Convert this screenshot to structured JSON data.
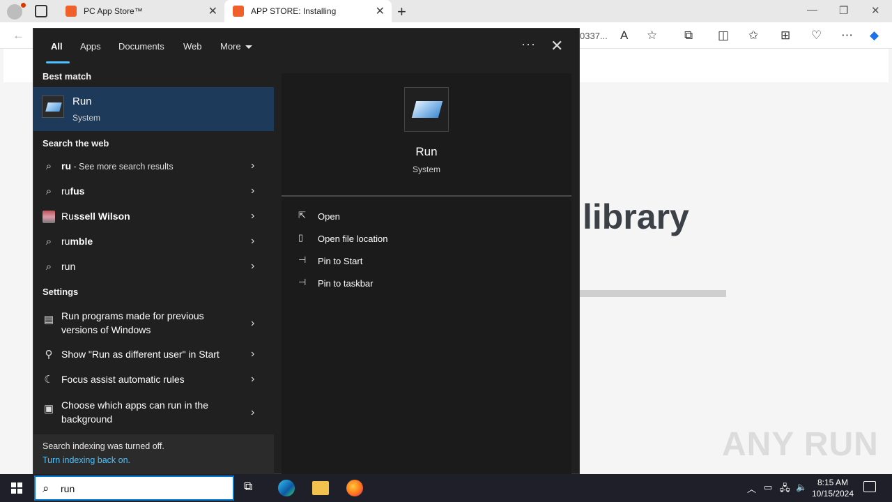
{
  "browser": {
    "tabs": [
      {
        "title": "PC App Store™"
      },
      {
        "title": "APP STORE: Installing"
      }
    ],
    "url_fragment": "0337..."
  },
  "page": {
    "heading": "library",
    "watermark": "ANY RUN"
  },
  "search": {
    "query": "run",
    "tabs": [
      "All",
      "Apps",
      "Documents",
      "Web",
      "More"
    ],
    "best_match_header": "Best match",
    "best_match": {
      "title": "Run",
      "subtitle": "System"
    },
    "web_header": "Search the web",
    "web_results": [
      {
        "prefix": "ru",
        "suffix": " - See more search results",
        "icon": "search-icon"
      },
      {
        "prefix": "ru",
        "suffix": "fus",
        "icon": "search-icon"
      },
      {
        "prefix": "Ru",
        "suffix": "ssell Wilson",
        "icon": "avatar-image"
      },
      {
        "prefix": "ru",
        "suffix": "mble",
        "icon": "search-icon"
      },
      {
        "prefix": "run",
        "suffix": "",
        "icon": "search-icon"
      }
    ],
    "settings_header": "Settings",
    "settings_results": [
      {
        "text": "Run programs made for previous versions of Windows",
        "icon": "compatibility-icon"
      },
      {
        "text": "Show \"Run as different user\" in Start",
        "icon": "user-switch-icon"
      },
      {
        "text": "Focus assist automatic rules",
        "icon": "moon-icon"
      },
      {
        "text": "Choose which apps can run in the background",
        "icon": "image-app-icon"
      }
    ],
    "indexing": {
      "line1": "Search indexing was turned off.",
      "link": "Turn indexing back on."
    },
    "preview": {
      "title": "Run",
      "subtitle": "System",
      "actions": [
        {
          "label": "Open",
          "icon": "open-icon"
        },
        {
          "label": "Open file location",
          "icon": "file-location-icon"
        },
        {
          "label": "Pin to Start",
          "icon": "pin-icon"
        },
        {
          "label": "Pin to taskbar",
          "icon": "pin-icon"
        }
      ]
    }
  },
  "taskbar": {
    "time": "8:15 AM",
    "date": "10/15/2024"
  }
}
